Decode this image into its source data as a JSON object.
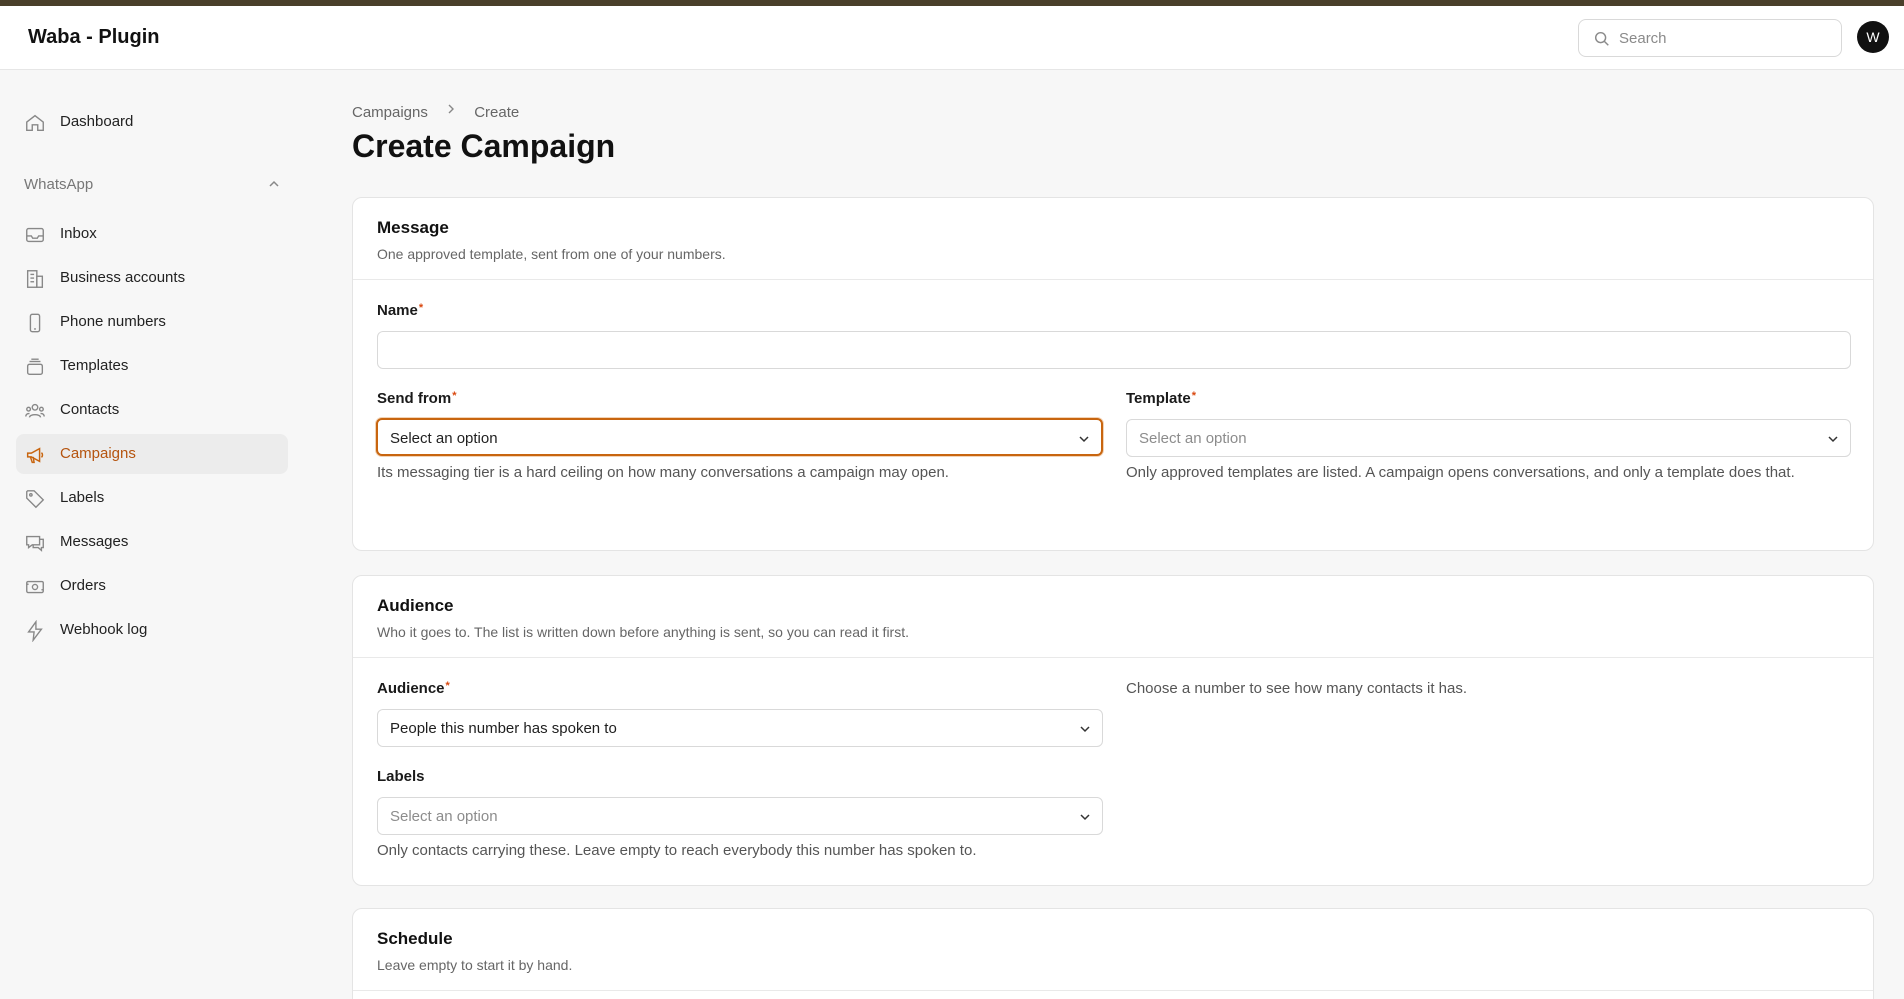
{
  "app": {
    "title": "Waba - Plugin"
  },
  "header": {
    "search_placeholder": "Search",
    "avatar_initial": "W"
  },
  "sidebar": {
    "dashboard": "Dashboard",
    "group_label": "WhatsApp",
    "items": [
      {
        "label": "Inbox",
        "icon": "inbox-icon"
      },
      {
        "label": "Business accounts",
        "icon": "building-icon"
      },
      {
        "label": "Phone numbers",
        "icon": "phone-icon"
      },
      {
        "label": "Templates",
        "icon": "template-stack-icon"
      },
      {
        "label": "Contacts",
        "icon": "users-icon"
      },
      {
        "label": "Campaigns",
        "icon": "megaphone-icon",
        "active": true
      },
      {
        "label": "Labels",
        "icon": "tag-icon"
      },
      {
        "label": "Messages",
        "icon": "chat-icon"
      },
      {
        "label": "Orders",
        "icon": "cash-icon"
      },
      {
        "label": "Webhook log",
        "icon": "bolt-icon"
      }
    ]
  },
  "breadcrumb": {
    "parent": "Campaigns",
    "current": "Create"
  },
  "page": {
    "title": "Create Campaign"
  },
  "message_section": {
    "title": "Message",
    "subtitle": "One approved template, sent from one of your numbers.",
    "name_label": "Name",
    "name_value": "",
    "send_from_label": "Send from",
    "send_from_value": "Select an option",
    "send_from_help": "Its messaging tier is a hard ceiling on how many conversations a campaign may open.",
    "template_label": "Template",
    "template_placeholder": "Select an option",
    "template_help": "Only approved templates are listed. A campaign opens conversations, and only a template does that."
  },
  "audience_section": {
    "title": "Audience",
    "subtitle": "Who it goes to. The list is written down before anything is sent, so you can read it first.",
    "audience_label": "Audience",
    "audience_value": "People this number has spoken to",
    "audience_help": "Choose a number to see how many contacts it has.",
    "labels_label": "Labels",
    "labels_placeholder": "Select an option",
    "labels_help": "Only contacts carrying these. Leave empty to reach everybody this number has spoken to."
  },
  "schedule_section": {
    "title": "Schedule",
    "subtitle": "Leave empty to start it by hand."
  },
  "colors": {
    "accent": "#c8650f",
    "active_text": "#b5540f",
    "topstrip": "#4a3f2a"
  }
}
